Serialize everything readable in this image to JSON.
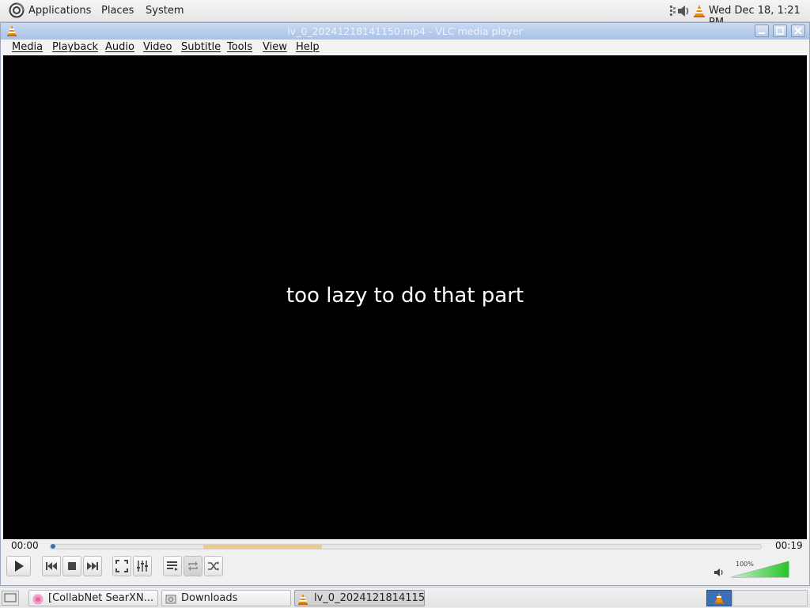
{
  "top_panel": {
    "applications": "Applications",
    "places": "Places",
    "system": "System",
    "clock": "Wed Dec 18,  1:21 PM"
  },
  "window": {
    "title": "lv_0_20241218141150.mp4 - VLC media player"
  },
  "menu": [
    "Media",
    "Playback",
    "Audio",
    "Video",
    "Subtitle",
    "Tools",
    "View",
    "Help"
  ],
  "video": {
    "subtitle": "too lazy to do that part"
  },
  "playback": {
    "elapsed": "00:00",
    "total": "00:19",
    "progress_fraction": 0.0,
    "buffered_fraction": [
      0.215,
      0.382
    ]
  },
  "volume": {
    "label": "100%",
    "level": 1.0
  },
  "taskbar": {
    "tasks": [
      "[CollabNet SearXN...",
      "Downloads",
      "lv_0_2024121814115..."
    ]
  },
  "colors": {
    "titlebar": "#b3c9ea",
    "vlc_orange": "#f08a00",
    "buffer": "#f0c884",
    "seek_handle": "#3a6fb0",
    "volume_green": "#2ecc40"
  }
}
